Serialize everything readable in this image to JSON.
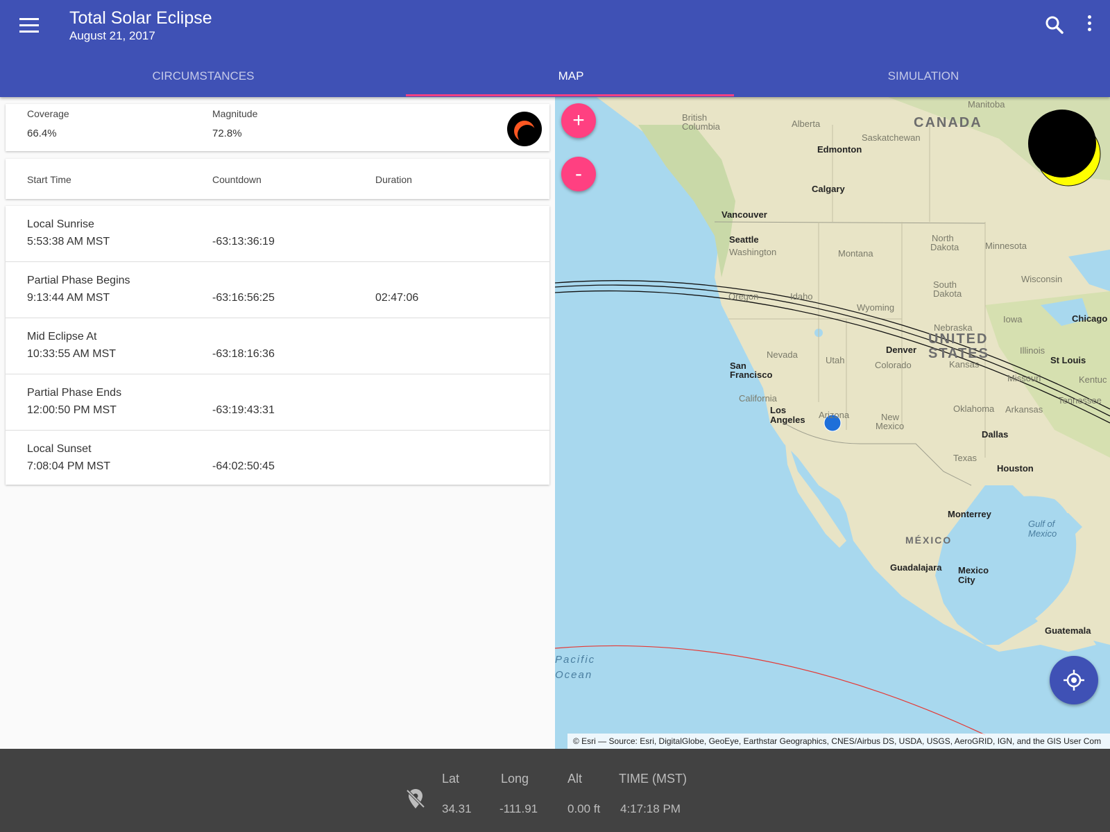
{
  "app": {
    "title": "Total Solar Eclipse",
    "subtitle": "August 21, 2017",
    "icons": {
      "menu": "menu-icon",
      "search": "search-icon",
      "more": "more-vert-icon"
    }
  },
  "tabs": [
    {
      "label": "CIRCUMSTANCES",
      "active": false
    },
    {
      "label": "MAP",
      "active": true
    },
    {
      "label": "SIMULATION",
      "active": false
    }
  ],
  "coverage": {
    "coverage_label": "Coverage",
    "coverage_value": "66.4%",
    "magnitude_label": "Magnitude",
    "magnitude_value": "72.8%"
  },
  "table": {
    "headers": {
      "start": "Start Time",
      "countdown": "Countdown",
      "duration": "Duration"
    },
    "rows": [
      {
        "name": "Local Sunrise",
        "time": "5:53:38 AM MST",
        "countdown": "-63:13:36:19",
        "duration": ""
      },
      {
        "name": "Partial Phase Begins",
        "time": "9:13:44 AM MST",
        "countdown": "-63:16:56:25",
        "duration": "02:47:06"
      },
      {
        "name": "Mid Eclipse At",
        "time": "10:33:55 AM MST",
        "countdown": "-63:18:16:36",
        "duration": ""
      },
      {
        "name": "Partial Phase Ends",
        "time": "12:00:50 PM MST",
        "countdown": "-63:19:43:31",
        "duration": ""
      },
      {
        "name": "Local Sunset",
        "time": "7:08:04 PM MST",
        "countdown": "-64:02:50:45",
        "duration": ""
      }
    ]
  },
  "map": {
    "zoom_in": "+",
    "zoom_out": "-",
    "attribution": "© Esri — Source: Esri, DigitalGlobe, GeoEye, Earthstar Geographics, CNES/Airbus DS, USDA, USGS, AeroGRID, IGN, and the GIS User Com",
    "countries": [
      "CANADA",
      "UNITED",
      "STATES",
      "MÉXICO"
    ],
    "oceans": [
      "Pacific",
      "Ocean",
      "Gulf of",
      "Mexico"
    ],
    "cities": [
      "Edmonton",
      "Calgary",
      "Vancouver",
      "Seattle",
      "San",
      "Francisco",
      "Los",
      "Angeles",
      "Denver",
      "Dallas",
      "Houston",
      "Chicago",
      "St Louis",
      "Monterrey",
      "Guadalajara",
      "Mexico",
      "City",
      "Guatemala"
    ],
    "states": [
      "British",
      "Columbia",
      "Alberta",
      "Saskatchewan",
      "Manitoba",
      "Washington",
      "Oregon",
      "Idaho",
      "Montana",
      "Wyoming",
      "North",
      "Dakota",
      "South",
      "Dakota",
      "Minnesota",
      "Wisconsin",
      "Iowa",
      "Nebraska",
      "Kansas",
      "Nevada",
      "Utah",
      "Colorado",
      "California",
      "Arizona",
      "New",
      "Mexico",
      "Texas",
      "Oklahoma",
      "Arkansas",
      "Missouri",
      "Illinois",
      "Tennessee",
      "Kentuc"
    ],
    "colors": {
      "water": "#a8d8ee",
      "land": "#e8e4c6",
      "path_line": "#111111",
      "limit_line": "#e53935",
      "location_dot": "#1e6fd9"
    }
  },
  "status": {
    "lat_label": "Lat",
    "lat_value": "34.31",
    "long_label": "Long",
    "long_value": "-111.91",
    "alt_label": "Alt",
    "alt_value": "0.00 ft",
    "time_label": "TIME (MST)",
    "time_value": "4:17:18 PM",
    "icon": "location-off-icon"
  }
}
